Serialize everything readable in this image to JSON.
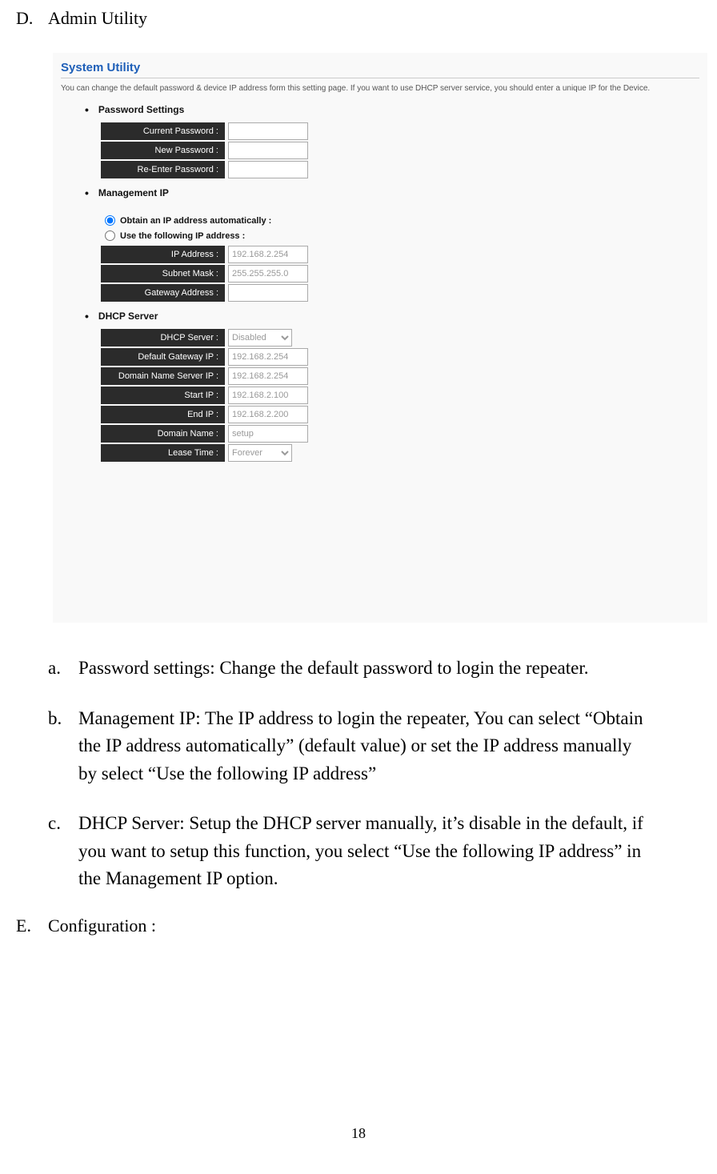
{
  "section_d": {
    "letter": "D.",
    "title": "Admin Utility"
  },
  "screenshot": {
    "title": "System Utility",
    "description": "You can change the default password & device IP address form this setting page. If you want to use DHCP server service, you should enter a unique IP for the Device.",
    "password": {
      "heading": "Password Settings",
      "current": "Current Password :",
      "new": "New Password :",
      "re": "Re-Enter Password :"
    },
    "mgmt": {
      "heading": "Management IP",
      "radio_auto": "Obtain an IP address automatically :",
      "radio_manual": "Use the following IP address :",
      "ip_label": "IP Address :",
      "ip_val": "192.168.2.254",
      "subnet_label": "Subnet Mask :",
      "subnet_val": "255.255.255.0",
      "gw_label": "Gateway Address :",
      "gw_val": ""
    },
    "dhcp": {
      "heading": "DHCP Server",
      "server_label": "DHCP Server :",
      "server_val": "Disabled",
      "dgw_label": "Default Gateway IP :",
      "dgw_val": "192.168.2.254",
      "dns_label": "Domain Name Server IP :",
      "dns_val": "192.168.2.254",
      "start_label": "Start IP :",
      "start_val": "192.168.2.100",
      "end_label": "End IP :",
      "end_val": "192.168.2.200",
      "domain_label": "Domain Name :",
      "domain_val": "setup",
      "lease_label": "Lease Time :",
      "lease_val": "Forever"
    }
  },
  "notes": {
    "a": {
      "letter": "a.",
      "text": "Password settings: Change the default password to login the repeater."
    },
    "b": {
      "letter": "b.",
      "text": "Management IP: The IP address to login the repeater, You can select “Obtain the IP address automatically” (default value) or set the IP address manually by select “Use the following IP address”"
    },
    "c": {
      "letter": "c.",
      "text": "DHCP Server: Setup the DHCP server manually, it’s disable in the default, if you want to setup this function, you select “Use the following IP address” in the Management IP option."
    }
  },
  "section_e": {
    "letter": "E.",
    "title": "Configuration :"
  },
  "page_number": "18"
}
